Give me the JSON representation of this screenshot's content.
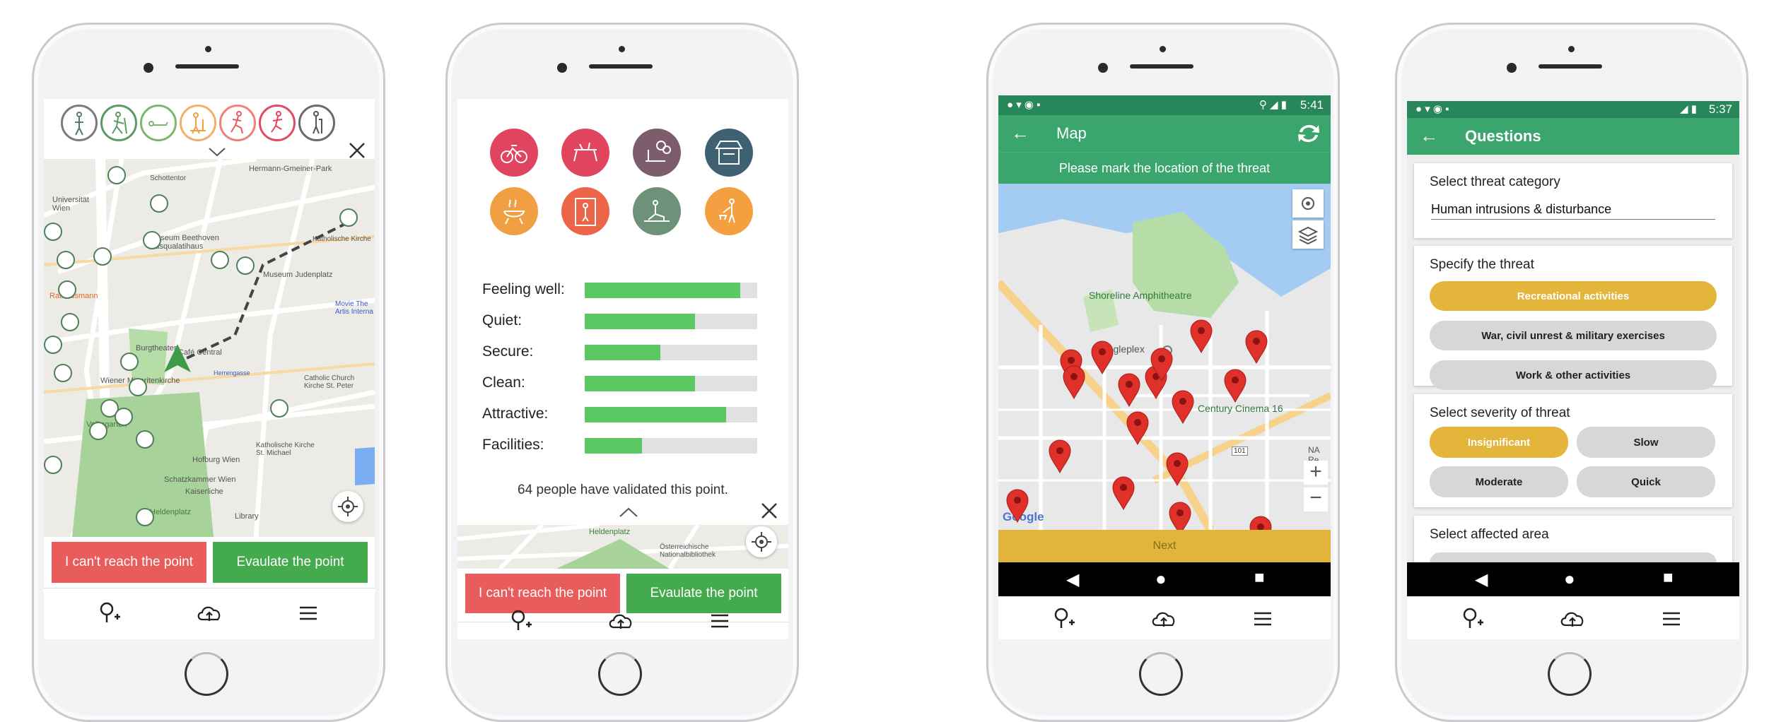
{
  "phone1": {
    "category_icons": [
      "walking-person-icon",
      "hiking-person-icon",
      "lying-person-icon",
      "children-play-icon",
      "running-person-icon",
      "jogging-person-icon",
      "elderly-person-icon"
    ],
    "map_labels": [
      "Universität Wien",
      "Museum Beethoven Pasqualatihaus",
      "Hermann-Gmeiner-Park",
      "Katholische Kirche",
      "Museum Judenplatz",
      "Movie The Artis Interna",
      "Burgtheater",
      "Café Central",
      "Wiener Minoritenkirche",
      "Herrengasse",
      "Catholic Church Kirche St. Peter",
      "Volksgarten",
      "Hofburg Wien",
      "Katholische Kirche St. Michael",
      "Schatzkammer Wien",
      "Kaiserliche",
      "Heldenplatz",
      "Library",
      "Rathausmann",
      "Schottentor"
    ],
    "cant_reach_label": "I can't reach the point",
    "evaluate_label": "Evaulate the point"
  },
  "phone2": {
    "category_colors": [
      "#e0445e",
      "#e2465e",
      "#7d5c6c",
      "#3e6271",
      "#f0a042",
      "#ec6548",
      "#6e917a",
      "#f5a040"
    ],
    "category_icons": [
      "cycling-icon",
      "picnic-icon",
      "playground-icon",
      "kiosk-icon",
      "barbecue-icon",
      "toilet-icon",
      "fitness-icon",
      "dog-walking-icon"
    ],
    "ratings": [
      {
        "label": "Feeling well:",
        "value": 0.9
      },
      {
        "label": "Quiet:",
        "value": 0.64
      },
      {
        "label": "Secure:",
        "value": 0.44
      },
      {
        "label": "Clean:",
        "value": 0.64
      },
      {
        "label": "Attractive:",
        "value": 0.82
      },
      {
        "label": "Facilities:",
        "value": 0.33
      }
    ],
    "validated_text": "64 people have validated this point.",
    "map_labels": [
      "Heldenplatz",
      "Österreichische Nationalbibliothek"
    ],
    "cant_reach_label": "I can't reach the point",
    "evaluate_label": "Evaulate the point"
  },
  "phone3": {
    "status_time": "5:41",
    "title": "Map",
    "instruction": "Please mark the location of the threat",
    "map_labels": [
      "Shoreline Amphitheatre",
      "Googleplex",
      "Century Cinema 16",
      "NA Re",
      "101",
      "Google"
    ],
    "next_label": "Next"
  },
  "phone4": {
    "status_time": "5:37",
    "title": "Questions",
    "category_title": "Select threat category",
    "category_value": "Human intrusions & disturbance",
    "specify_title": "Specify the threat",
    "threat_options": [
      "Recreational activities",
      "War, civil unrest & military exercises",
      "Work & other activities"
    ],
    "severity_title": "Select severity of threat",
    "severity_options": [
      "Insignificant",
      "Slow",
      "Moderate",
      "Quick"
    ],
    "affected_title": "Select affected area"
  },
  "colors": {
    "green_accent": "#3aa56c",
    "status_green": "#27875a",
    "red_button": "#e85c5c",
    "green_button": "#43aa4e",
    "selected_pill": "#e4b53b",
    "next_bar": "#e1b43b",
    "pin_red": "#e0302a"
  }
}
